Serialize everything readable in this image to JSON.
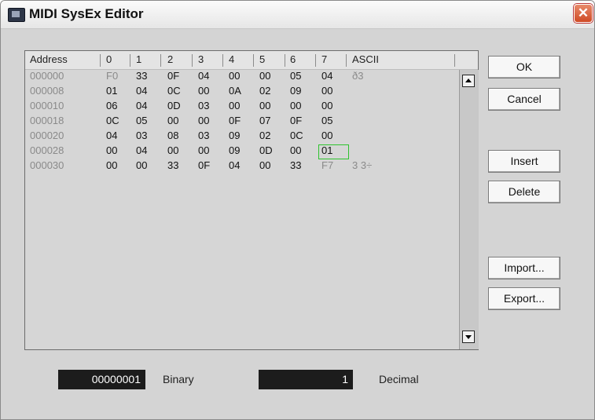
{
  "window": {
    "title": "MIDI SysEx Editor",
    "close_symbol": "✕"
  },
  "table": {
    "headers": [
      "Address",
      "0",
      "1",
      "2",
      "3",
      "4",
      "5",
      "6",
      "7",
      "ASCII"
    ],
    "rows": [
      {
        "address": "000000",
        "bytes": [
          "F0",
          "33",
          "0F",
          "04",
          "00",
          "00",
          "05",
          "04"
        ],
        "ascii": "ð3"
      },
      {
        "address": "000008",
        "bytes": [
          "01",
          "04",
          "0C",
          "00",
          "0A",
          "02",
          "09",
          "00"
        ],
        "ascii": ""
      },
      {
        "address": "000010",
        "bytes": [
          "06",
          "04",
          "0D",
          "03",
          "00",
          "00",
          "00",
          "00"
        ],
        "ascii": ""
      },
      {
        "address": "000018",
        "bytes": [
          "0C",
          "05",
          "00",
          "00",
          "0F",
          "07",
          "0F",
          "05"
        ],
        "ascii": ""
      },
      {
        "address": "000020",
        "bytes": [
          "04",
          "03",
          "08",
          "03",
          "09",
          "02",
          "0C",
          "00"
        ],
        "ascii": ""
      },
      {
        "address": "000028",
        "bytes": [
          "00",
          "04",
          "00",
          "00",
          "09",
          "0D",
          "00",
          "01"
        ],
        "ascii": ""
      },
      {
        "address": "000030",
        "bytes": [
          "00",
          "00",
          "33",
          "0F",
          "04",
          "00",
          "33",
          "F7"
        ],
        "ascii": "3  3÷"
      }
    ],
    "selected_cell": {
      "row": 5,
      "column": 7
    }
  },
  "buttons": {
    "ok": "OK",
    "cancel": "Cancel",
    "insert": "Insert",
    "delete": "Delete",
    "import": "Import...",
    "export": "Export..."
  },
  "fields": {
    "binary_value": "00000001",
    "binary_label": "Binary",
    "decimal_value": "1",
    "decimal_label": "Decimal"
  },
  "colors": {
    "selection_border": "#2ec32e",
    "close_button": "#d9532c",
    "field_background": "#1c1c1c"
  }
}
